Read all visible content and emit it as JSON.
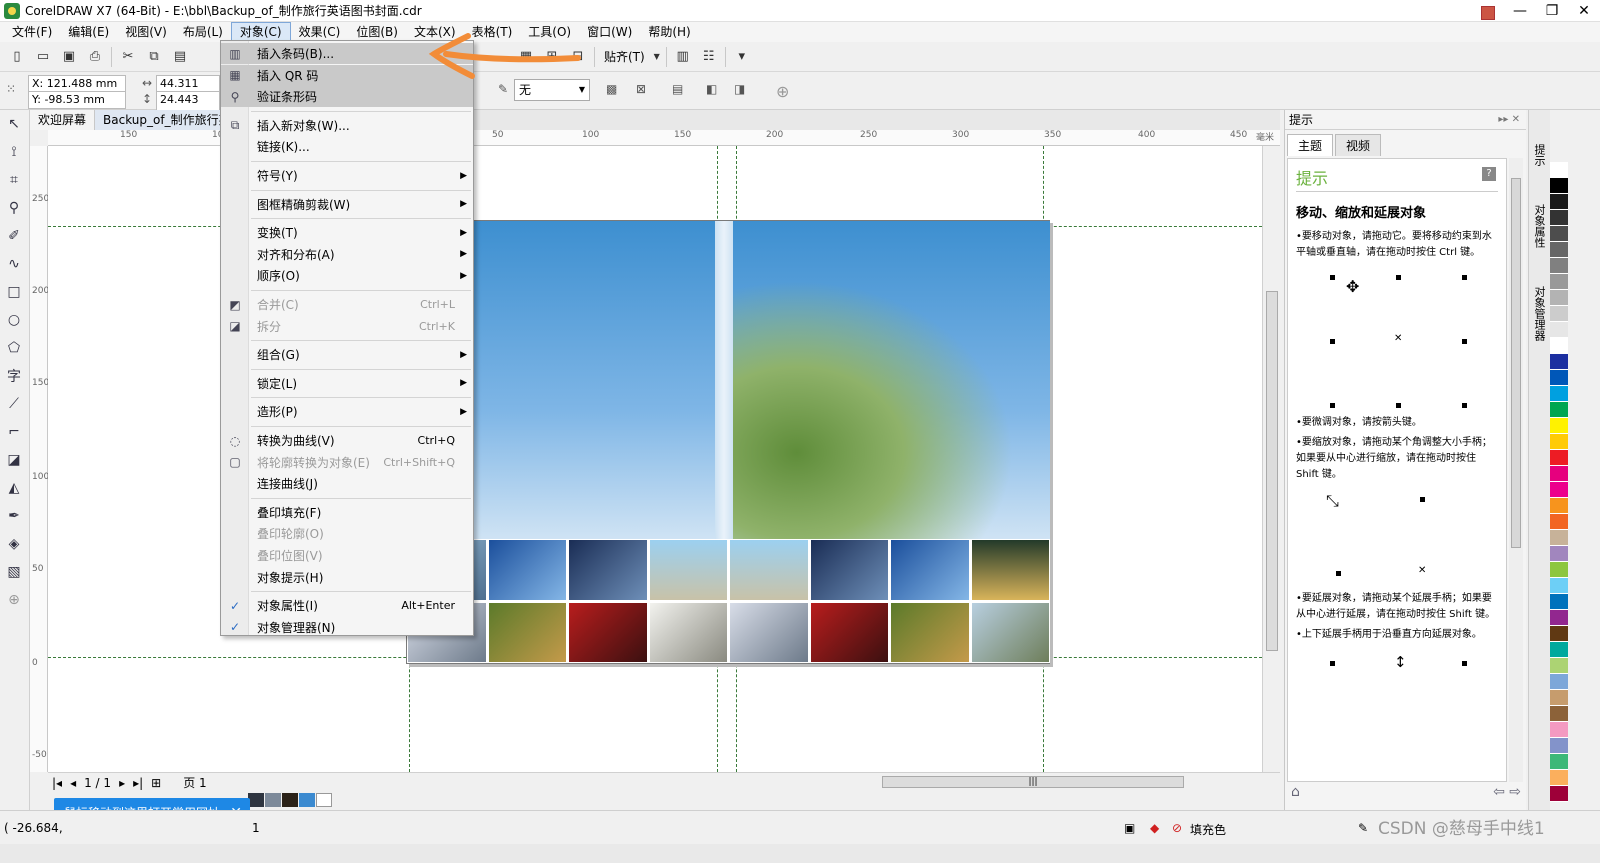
{
  "title": "CorelDRAW X7 (64-Bit) - E:\\bbl\\Backup_of_制作旅行英语图书封面.cdr",
  "menubar": [
    "文件(F)",
    "编辑(E)",
    "视图(V)",
    "布局(L)",
    "对象(C)",
    "效果(C)",
    "位图(B)",
    "文本(X)",
    "表格(T)",
    "工具(O)",
    "窗口(W)",
    "帮助(H)"
  ],
  "toolbar": {
    "snap": "贴齐(T)"
  },
  "propbar": {
    "x": "X: 121.488 mm",
    "y": "Y: -98.53 mm",
    "w": "44.311 mm",
    "h": "24.443 mm",
    "outline": "无"
  },
  "doctabs": [
    "欢迎屏幕",
    "Backup_of_制作旅行英"
  ],
  "ruler_h": [
    "150",
    "100",
    "50",
    "100",
    "150",
    "200",
    "250",
    "300",
    "350",
    "400",
    "450"
  ],
  "ruler_h_unit": "毫米",
  "ruler_v": [
    "250",
    "200",
    "150",
    "100",
    "50",
    "0",
    "-50"
  ],
  "menu": {
    "items": [
      {
        "icon": "barcode-icon",
        "label": "插入条码(B)...",
        "shortcut": "",
        "sub": false,
        "disabled": false,
        "hl": true
      },
      {
        "icon": "qrcode-icon",
        "label": "插入 QR 码",
        "shortcut": "",
        "sub": false,
        "disabled": false,
        "hl": true
      },
      {
        "icon": "magnify-icon",
        "label": "验证条形码",
        "shortcut": "",
        "sub": false,
        "disabled": false,
        "hl": true
      },
      {
        "icon": "ole-icon",
        "label": "插入新对象(W)...",
        "shortcut": "",
        "sub": false,
        "disabled": false,
        "hl": false
      },
      {
        "icon": "",
        "label": "链接(K)...",
        "shortcut": "",
        "sub": false,
        "disabled": false,
        "hl": false
      },
      {
        "icon": "",
        "label": "符号(Y)",
        "shortcut": "",
        "sub": true,
        "disabled": false,
        "hl": false
      },
      {
        "icon": "",
        "label": "图框精确剪裁(W)",
        "shortcut": "",
        "sub": true,
        "disabled": false,
        "hl": false
      },
      {
        "icon": "",
        "label": "变换(T)",
        "shortcut": "",
        "sub": true,
        "disabled": false,
        "hl": false
      },
      {
        "icon": "",
        "label": "对齐和分布(A)",
        "shortcut": "",
        "sub": true,
        "disabled": false,
        "hl": false
      },
      {
        "icon": "",
        "label": "顺序(O)",
        "shortcut": "",
        "sub": true,
        "disabled": false,
        "hl": false
      },
      {
        "icon": "combine-icon",
        "label": "合并(C)",
        "shortcut": "Ctrl+L",
        "sub": false,
        "disabled": true,
        "hl": false
      },
      {
        "icon": "break-icon",
        "label": "拆分",
        "shortcut": "Ctrl+K",
        "sub": false,
        "disabled": true,
        "hl": false
      },
      {
        "icon": "",
        "label": "组合(G)",
        "shortcut": "",
        "sub": true,
        "disabled": false,
        "hl": false
      },
      {
        "icon": "",
        "label": "锁定(L)",
        "shortcut": "",
        "sub": true,
        "disabled": false,
        "hl": false
      },
      {
        "icon": "",
        "label": "造形(P)",
        "shortcut": "",
        "sub": true,
        "disabled": false,
        "hl": false
      },
      {
        "icon": "curve-icon",
        "label": "转换为曲线(V)",
        "shortcut": "Ctrl+Q",
        "sub": false,
        "disabled": false,
        "hl": false
      },
      {
        "icon": "outline-icon",
        "label": "将轮廓转换为对象(E)",
        "shortcut": "Ctrl+Shift+Q",
        "sub": false,
        "disabled": true,
        "hl": false
      },
      {
        "icon": "",
        "label": "连接曲线(J)",
        "shortcut": "",
        "sub": false,
        "disabled": false,
        "hl": false
      },
      {
        "icon": "",
        "label": "叠印填充(F)",
        "shortcut": "",
        "sub": false,
        "disabled": false,
        "hl": false
      },
      {
        "icon": "",
        "label": "叠印轮廓(O)",
        "shortcut": "",
        "sub": false,
        "disabled": true,
        "hl": false
      },
      {
        "icon": "",
        "label": "叠印位图(V)",
        "shortcut": "",
        "sub": false,
        "disabled": true,
        "hl": false
      },
      {
        "icon": "",
        "label": "对象提示(H)",
        "shortcut": "",
        "sub": false,
        "disabled": false,
        "hl": false
      },
      {
        "icon": "check-icon",
        "label": "对象属性(I)",
        "shortcut": "Alt+Enter",
        "sub": false,
        "disabled": false,
        "hl": false
      },
      {
        "icon": "check-icon",
        "label": "对象管理器(N)",
        "shortcut": "",
        "sub": false,
        "disabled": false,
        "hl": false
      }
    ]
  },
  "docker": {
    "header": "提示",
    "tabs": [
      "主题",
      "视频"
    ],
    "hint_title": "提示",
    "hint_head": "移动、缩放和延展对象",
    "p1": "•要移动对象，请拖动它。要将移动约束到水平轴或垂直轴，请在拖动时按住 Ctrl 键。",
    "p2": "•要微调对象，请按箭头键。",
    "p3": "•要缩放对象，请拖动某个角调整大小手柄；如果要从中心进行缩放，请在拖动时按住 Shift 键。",
    "p4": "•要延展对象，请拖动某个延展手柄；如果要从中心进行延展，请在拖动时按住 Shift 键。",
    "p5": "•上下延展手柄用于沿垂直方向延展对象。"
  },
  "sidetabs": [
    "提示",
    "对象属性",
    "对象管理器"
  ],
  "pagenav": {
    "count": "1 / 1",
    "page": "页 1"
  },
  "tip": "鼠标移动到这里打开常用网址",
  "status": {
    "coords": "( -26.684,",
    "layer": "1",
    "fill": "填充色"
  },
  "watermark": "CSDN @慈母手中线1",
  "colors": {
    "accent": "#1e88e5",
    "arrow": "#f28c38",
    "sky": "#3d8fd0"
  },
  "palette": [
    "#ffffff",
    "#000000",
    "#1a1a1a",
    "#333333",
    "#4d4d4d",
    "#666666",
    "#808080",
    "#999999",
    "#b3b3b3",
    "#cccccc",
    "#e6e6e6",
    "#ffffff",
    "#1c2fa0",
    "#0057b8",
    "#00a0e0",
    "#00a651",
    "#fff200",
    "#ffcb05",
    "#ed1c24",
    "#e6007e",
    "#ec008c",
    "#f7941d",
    "#f26522",
    "#c7b299",
    "#a186be",
    "#8dc63f",
    "#6dcff6",
    "#0072bc",
    "#92278f",
    "#603913",
    "#00a99d",
    "#acd373",
    "#7da7d9",
    "#c69c6d",
    "#8c6239",
    "#f49ac1",
    "#8393ca",
    "#3cb878",
    "#fbaf5d",
    "#9e0039"
  ]
}
